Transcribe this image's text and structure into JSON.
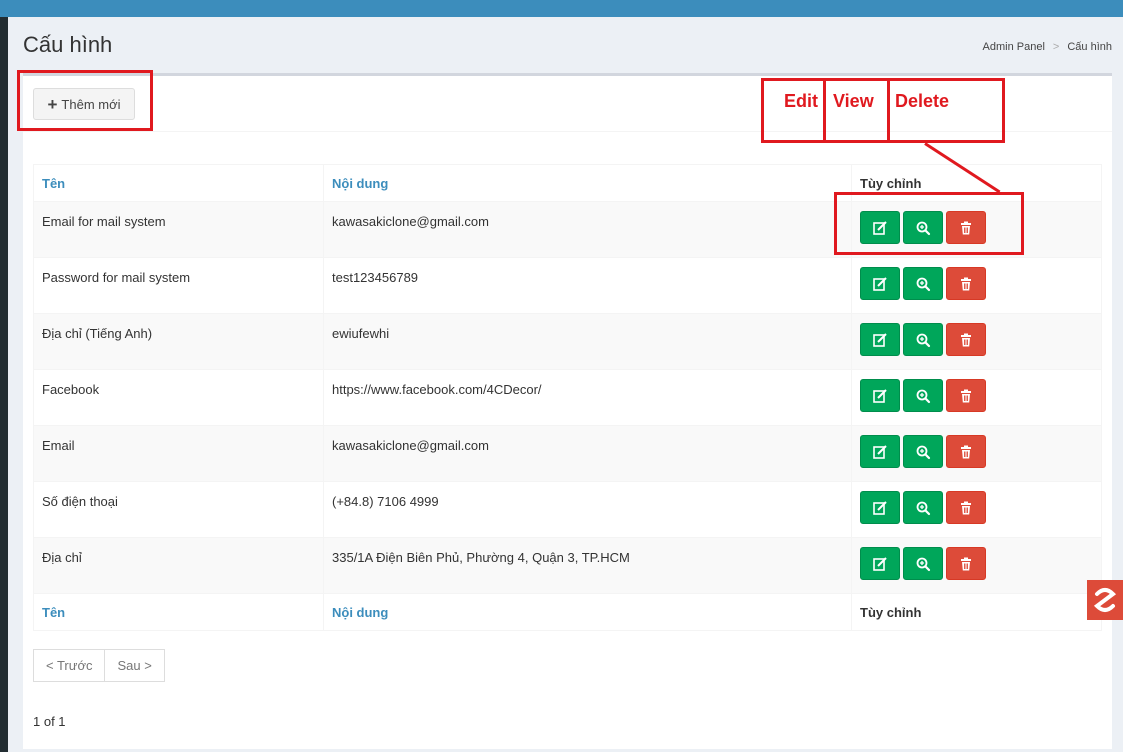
{
  "page": {
    "title": "Cấu hình"
  },
  "breadcrumb": {
    "root": "Admin Panel",
    "separator": ">",
    "current": "Cấu hình"
  },
  "toolbar": {
    "add_label": "Thêm mới"
  },
  "table": {
    "columns": [
      "Tên",
      "Nội dung",
      "Tùy chỉnh"
    ],
    "rows": [
      {
        "name": "Email for mail system",
        "value": "kawasakiclone@gmail.com"
      },
      {
        "name": "Password for mail system",
        "value": "test123456789"
      },
      {
        "name": "Địa chỉ (Tiếng Anh)",
        "value": "ewiufewhi"
      },
      {
        "name": "Facebook",
        "value": "https://www.facebook.com/4CDecor/"
      },
      {
        "name": "Email",
        "value": "kawasakiclone@gmail.com"
      },
      {
        "name": "Số điện thoại",
        "value": "(+84.8) 7106 4999"
      },
      {
        "name": "Địa chỉ",
        "value": "335/1A Điện Biên Phủ, Phường 4, Quận 3, TP.HCM"
      }
    ]
  },
  "pagination": {
    "prev": "< Trước",
    "next": "Sau >",
    "info": "1 of 1"
  },
  "annotations": {
    "edit": "Edit",
    "view": "View",
    "delete": "Delete"
  },
  "colors": {
    "accent": "#3c8dbc",
    "success": "#00a65a",
    "danger": "#dd4b39",
    "annotation": "#e0191f"
  },
  "icons": {
    "edit": "edit-icon",
    "view": "zoom-icon",
    "delete": "trash-icon",
    "add": "plus-icon"
  }
}
